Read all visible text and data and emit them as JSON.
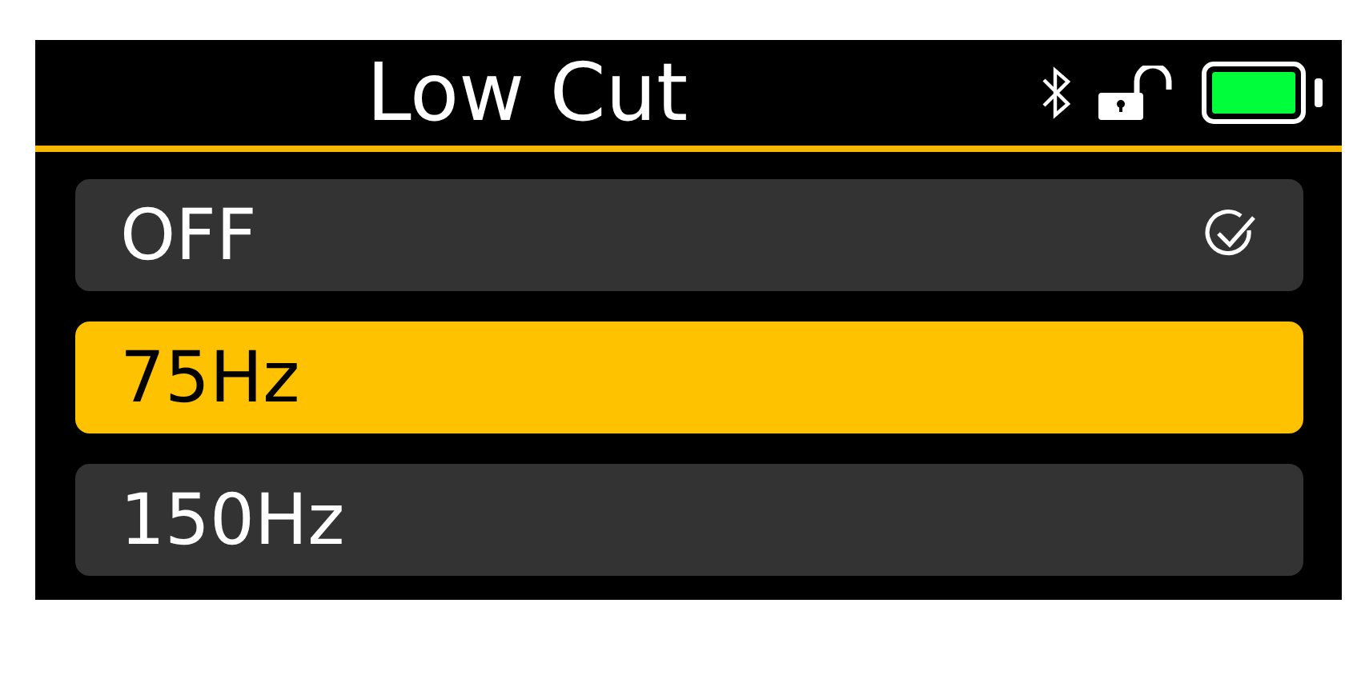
{
  "header": {
    "title": "Low Cut"
  },
  "options": [
    {
      "label": "OFF",
      "selected": false,
      "checked": true
    },
    {
      "label": "75Hz",
      "selected": true,
      "checked": false
    },
    {
      "label": "150Hz",
      "selected": false,
      "checked": false
    }
  ]
}
